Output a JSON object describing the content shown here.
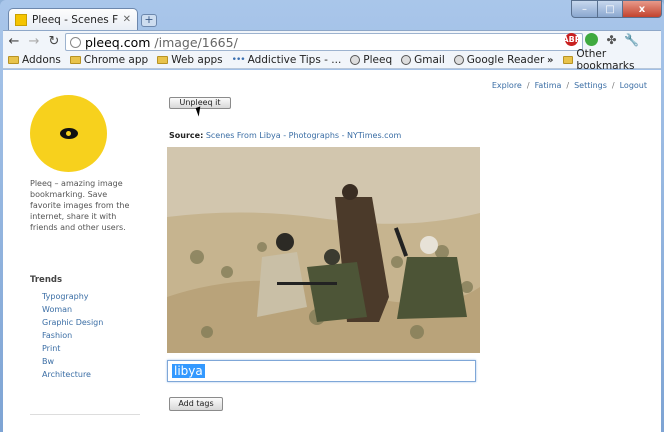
{
  "browser": {
    "tab_title": "Pleeq - Scenes From L",
    "new_tab_label": "+",
    "window_controls": {
      "minimize": "–",
      "maximize": "□",
      "close": "x"
    },
    "url_host": "pleeq.com",
    "url_path": "/image/1665/",
    "back": "←",
    "forward": "→",
    "reload": "↻",
    "extensions": [
      "ABP",
      "green-ext",
      "puzzle",
      "wrench"
    ]
  },
  "bookmarks": {
    "items": [
      {
        "label": "Addons",
        "icon": "folder-icon"
      },
      {
        "label": "Chrome app",
        "icon": "folder-icon"
      },
      {
        "label": "Web apps",
        "icon": "folder-icon"
      },
      {
        "label": "Addictive Tips - ...",
        "icon": "dots-icon"
      },
      {
        "label": "Pleeq",
        "icon": "globe-icon"
      },
      {
        "label": "Gmail",
        "icon": "globe-icon"
      },
      {
        "label": "Google Reader",
        "icon": "globe-icon"
      }
    ],
    "overflow": "»",
    "other": "Other bookmarks"
  },
  "page": {
    "nav": [
      "Explore",
      "Fatima",
      "Settings",
      "Logout"
    ],
    "nav_separator": "/",
    "about": "Pleeq – amazing image bookmarking. Save favorite images from the internet, share it with friends and other users.",
    "trends_title": "Trends",
    "trends": [
      "Typography",
      "Woman",
      "Graphic Design",
      "Fashion",
      "Print",
      "Bw",
      "Architecture"
    ],
    "unpleeq_label": "Unpleeq it",
    "source_label": "Source:",
    "source_link": "Scenes From Libya - Photographs - NYTimes.com",
    "tag_value": "libya",
    "add_tags_label": "Add tags"
  },
  "colors": {
    "brand_yellow": "#f7d11d",
    "link": "#3b6ea5",
    "selection": "#3399ff"
  }
}
